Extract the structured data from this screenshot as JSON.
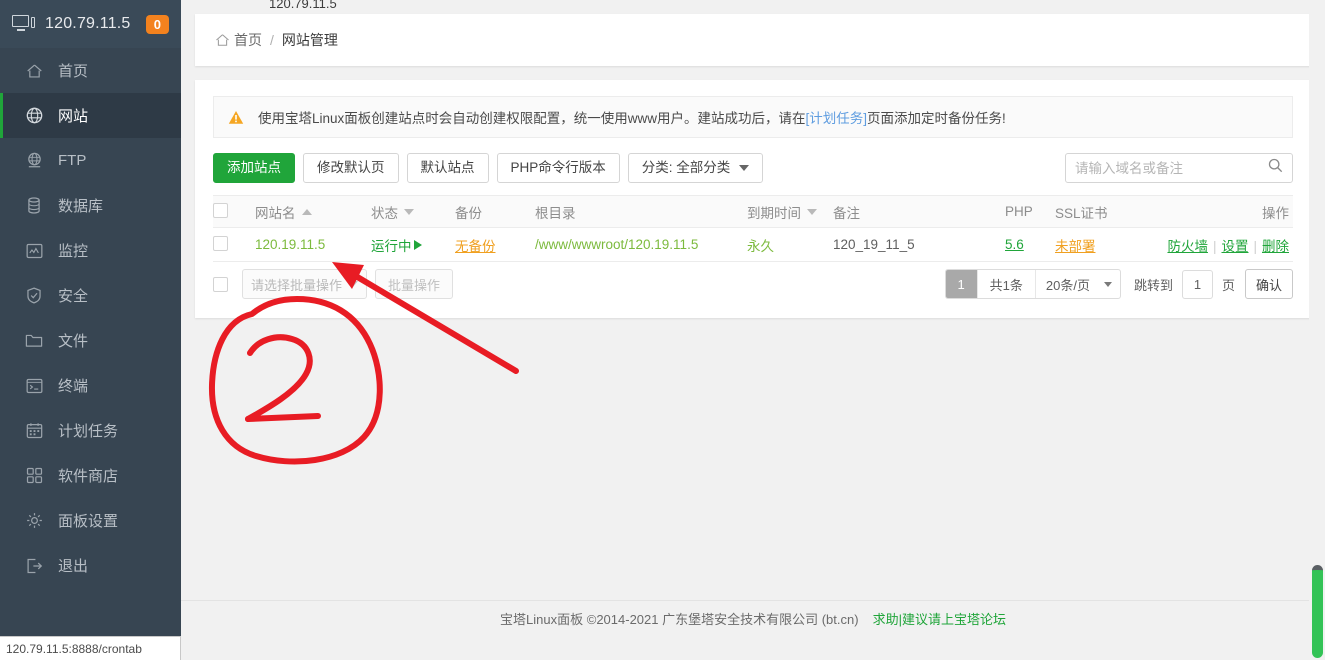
{
  "sidebar": {
    "host": "120.79.11.5",
    "badge": "0",
    "icon": "monitor-icon",
    "items": [
      {
        "label": "首页",
        "icon": "home-icon",
        "active": false
      },
      {
        "label": "网站",
        "icon": "globe-icon",
        "active": true
      },
      {
        "label": "FTP",
        "icon": "ftp-icon",
        "active": false
      },
      {
        "label": "数据库",
        "icon": "database-icon",
        "active": false
      },
      {
        "label": "监控",
        "icon": "chart-icon",
        "active": false
      },
      {
        "label": "安全",
        "icon": "shield-icon",
        "active": false
      },
      {
        "label": "文件",
        "icon": "folder-icon",
        "active": false
      },
      {
        "label": "终端",
        "icon": "terminal-icon",
        "active": false
      },
      {
        "label": "计划任务",
        "icon": "calendar-icon",
        "active": false
      },
      {
        "label": "软件商店",
        "icon": "grid-icon",
        "active": false
      },
      {
        "label": "面板设置",
        "icon": "gear-icon",
        "active": false
      },
      {
        "label": "退出",
        "icon": "logout-icon",
        "active": false
      }
    ]
  },
  "browser": {
    "url_label": "120.79.11.5",
    "status_link": "120.79.11.5:8888/crontab"
  },
  "breadcrumb": {
    "home_icon": "home-icon",
    "home": "首页",
    "separator": "/",
    "current": "网站管理"
  },
  "notice": {
    "icon": "warning-icon",
    "part1": "使用宝塔Linux面板创建站点时会自动创建权限配置，统一使用www用户。建站成功后，请在",
    "link": "[计划任务]",
    "part2": "页面添加定时备份任务!"
  },
  "toolbar": {
    "add_site": "添加站点",
    "modify_default_page": "修改默认页",
    "default_site": "默认站点",
    "php_cli_version": "PHP命令行版本",
    "category": "分类: 全部分类",
    "search_placeholder": "请输入域名或备注",
    "search_value": "",
    "search_icon": "search-icon"
  },
  "table": {
    "columns": [
      {
        "label": "网站名",
        "sort": "asc"
      },
      {
        "label": "状态",
        "sort": "desc"
      },
      {
        "label": "备份",
        "sort": ""
      },
      {
        "label": "根目录",
        "sort": ""
      },
      {
        "label": "到期时间",
        "sort": "desc"
      },
      {
        "label": "备注",
        "sort": ""
      },
      {
        "label": "PHP",
        "sort": ""
      },
      {
        "label": "SSL证书",
        "sort": ""
      },
      {
        "label": "操作",
        "sort": ""
      }
    ],
    "rows": [
      {
        "name": "120.19.11.5",
        "status": "运行中",
        "backup": "无备份",
        "root": "/www/wwwroot/120.19.11.5",
        "expire": "永久",
        "note": "120_19_11_5",
        "php": "5.6",
        "ssl": "未部署",
        "ops": [
          "防火墙",
          "设置",
          "删除"
        ]
      }
    ]
  },
  "table_footer": {
    "batch_placeholder": "请选择批量操作",
    "batch_button": "批量操作",
    "page_current": "1",
    "total_text": "共1条",
    "page_size": "20条/页",
    "jump_label": "跳转到",
    "jump_value": "1",
    "page_unit": "页",
    "confirm": "确认"
  },
  "footer": {
    "text": "宝塔Linux面板 ©2014-2021 广东堡塔安全技术有限公司 (bt.cn)",
    "link": "求助|建议请上宝塔论坛"
  },
  "annotation": {
    "marker": "2",
    "color": "#e81c24"
  },
  "colors": {
    "sidebar_bg": "#374552",
    "sidebar_active": "#2e3a46",
    "accent_green": "#20a53a",
    "badge_orange": "#f3821e",
    "warn_orange": "#f0a020",
    "link_blue": "#5f9de0"
  }
}
